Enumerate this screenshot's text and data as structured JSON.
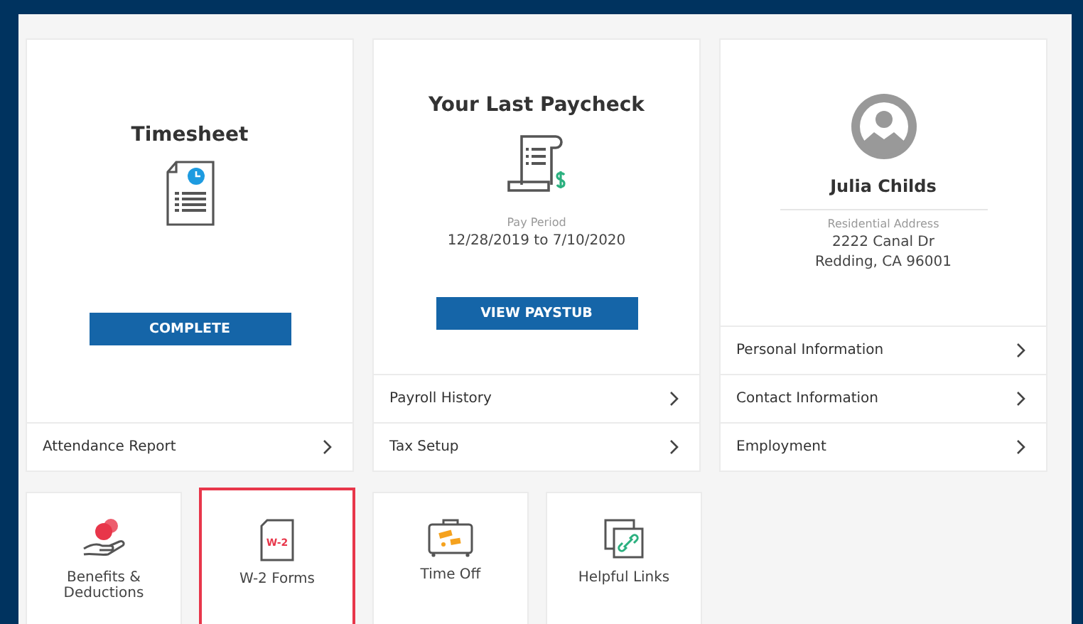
{
  "cards": [
    {
      "kind": "timesheet",
      "title": "Timesheet",
      "button": "COMPLETE",
      "links": [
        {
          "label": "Attendance Report"
        }
      ]
    },
    {
      "kind": "paycheck",
      "title": "Your Last Paycheck",
      "caption": "Pay Period",
      "period": "12/28/2019 to 7/10/2020",
      "button": "VIEW PAYSTUB",
      "links": [
        {
          "label": "Payroll History"
        },
        {
          "label": "Tax Setup"
        }
      ]
    },
    {
      "kind": "profile",
      "name": "Julia Childs",
      "caption": "Residential Address",
      "address": [
        "2222 Canal Dr",
        "Redding, CA 96001"
      ],
      "links": [
        {
          "label": "Personal Information"
        },
        {
          "label": "Contact Information"
        },
        {
          "label": "Employment"
        }
      ]
    }
  ],
  "tiles": [
    {
      "kind": "benefits",
      "label": "Benefits & Deductions",
      "selected": false
    },
    {
      "kind": "w2",
      "label": "W-2 Forms",
      "icon_text": "W-2",
      "selected": true
    },
    {
      "kind": "timeoff",
      "label": "Time Off",
      "selected": false
    },
    {
      "kind": "links",
      "label": "Helpful Links",
      "selected": false
    }
  ]
}
